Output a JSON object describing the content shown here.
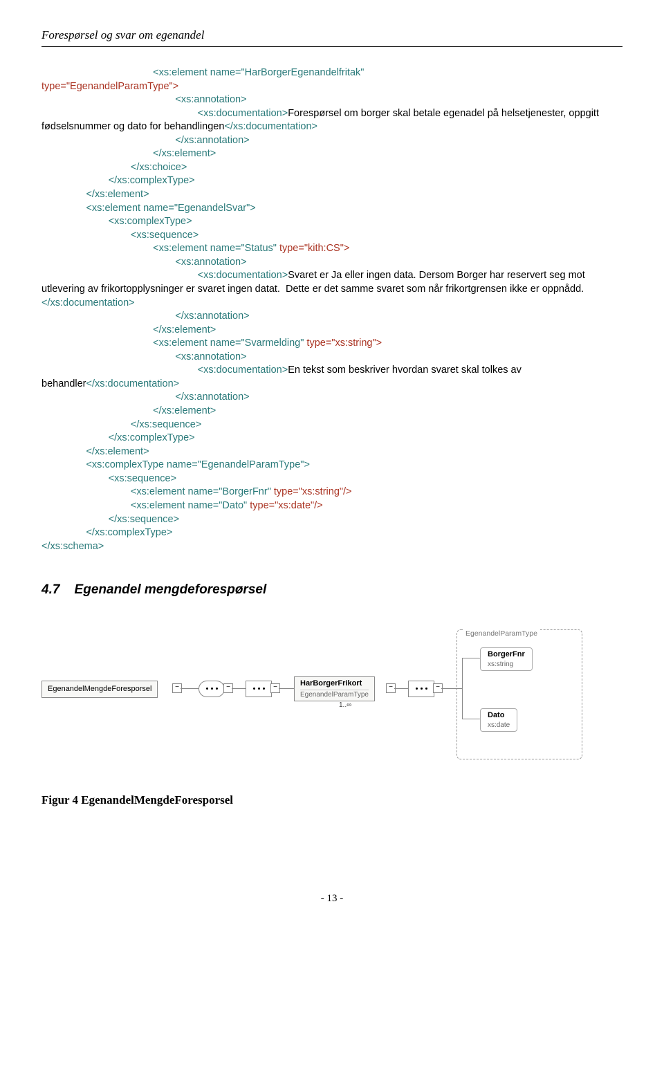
{
  "header": {
    "title": "Forespørsel og svar om egenandel"
  },
  "page": {
    "number": "- 13 -"
  },
  "section": {
    "number": "4.7",
    "title": "Egenandel mengdeforespørsel"
  },
  "figure": {
    "caption": "Figur 4 EgenandelMengdeForesporsel"
  },
  "code": {
    "l1a": "<xs:element name=\"HarBorgerEgenandelfritak\"",
    "l1b": "type=\"EgenandelParamType\">",
    "l2": "<xs:annotation>",
    "l3a": "<xs:documentation>",
    "l3b": "Forespørsel om borger skal betale egenadel på helsetjenester, oppgitt fødselsnummer og dato for behandlingen",
    "l3c": "</xs:documentation>",
    "l4": "</xs:annotation>",
    "l5": "</xs:element>",
    "l6": "</xs:choice>",
    "l7": "</xs:complexType>",
    "l8": "</xs:element>",
    "l9": "<xs:element name=\"EgenandelSvar\">",
    "l10": "<xs:complexType>",
    "l11": "<xs:sequence>",
    "l12a": "<xs:element name=\"Status\"",
    "l12b": " type=\"kith:CS\">",
    "l13": "<xs:annotation>",
    "l14a": "<xs:documentation>",
    "l14b": "Svaret er Ja eller ingen data. Dersom Borger har reservert seg mot utlevering av frikortopplysninger er svaret ingen datat.  Dette er det samme svaret som når frikortgrensen ikke er oppnådd.",
    "l14c": "</xs:documentation>",
    "l15": "</xs:annotation>",
    "l16": "</xs:element>",
    "l17a": "<xs:element name=\"Svarmelding\"",
    "l17b": " type=\"xs:string\">",
    "l18": "<xs:annotation>",
    "l19a": "<xs:documentation>",
    "l19b": "En tekst som beskriver hvordan svaret skal tolkes av behandler",
    "l19c": "</xs:documentation>",
    "l20": "</xs:annotation>",
    "l21": "</xs:element>",
    "l22": "</xs:sequence>",
    "l23": "</xs:complexType>",
    "l24": "</xs:element>",
    "l25": "<xs:complexType name=\"EgenandelParamType\">",
    "l26": "<xs:sequence>",
    "l27a": "<xs:element name=\"BorgerFnr\"",
    "l27b": " type=\"xs:string\"/>",
    "l28a": "<xs:element name=\"Dato\"",
    "l28b": " type=\"xs:date\"/>",
    "l29": "</xs:sequence>",
    "l30": "</xs:complexType>",
    "l31": "</xs:schema>"
  },
  "diagram": {
    "root": "EgenandelMengdeForesporsel",
    "child_name": "HarBorgerFrikort",
    "child_type": "EgenandelParamType",
    "child_mult": "1..∞",
    "group": "EgenandelParamType",
    "attr1_name": "BorgerFnr",
    "attr1_type": "xs:string",
    "attr2_name": "Dato",
    "attr2_type": "xs:date"
  }
}
